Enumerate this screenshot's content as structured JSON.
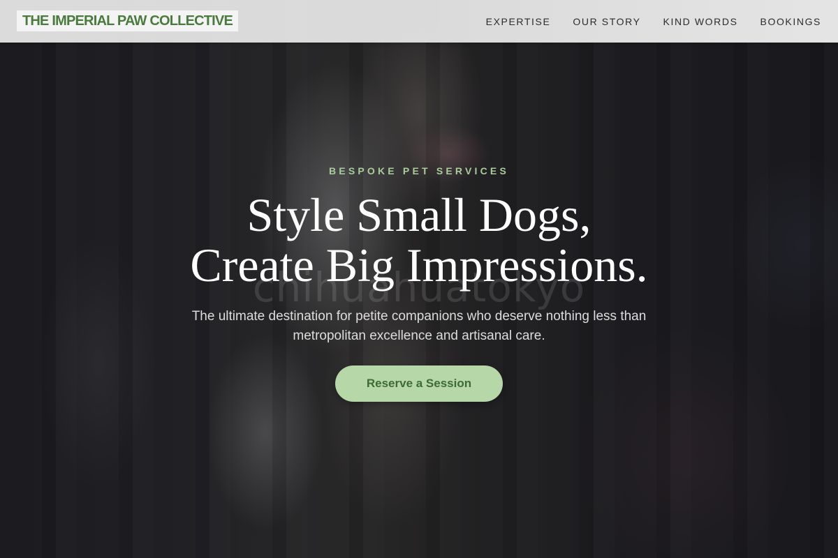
{
  "brand": {
    "name": "THE IMPERIAL PAW COLLECTIVE",
    "color": "#4a7a3d"
  },
  "nav": {
    "items": [
      {
        "label": "EXPERTISE"
      },
      {
        "label": "OUR STORY"
      },
      {
        "label": "KIND WORDS"
      },
      {
        "label": "BOOKINGS"
      }
    ]
  },
  "hero": {
    "eyebrow": "BESPOKE PET SERVICES",
    "headline_line1": "Style Small Dogs,",
    "headline_line2": "Create Big Impressions.",
    "subtext": "The ultimate destination for petite companions who deserve nothing less than metropolitan excellence and artisanal care.",
    "cta_label": "Reserve a Session",
    "watermark": "chihuahuatokyo"
  },
  "colors": {
    "accent": "#b6d8a9",
    "eyebrow": "#a9cd9b"
  }
}
